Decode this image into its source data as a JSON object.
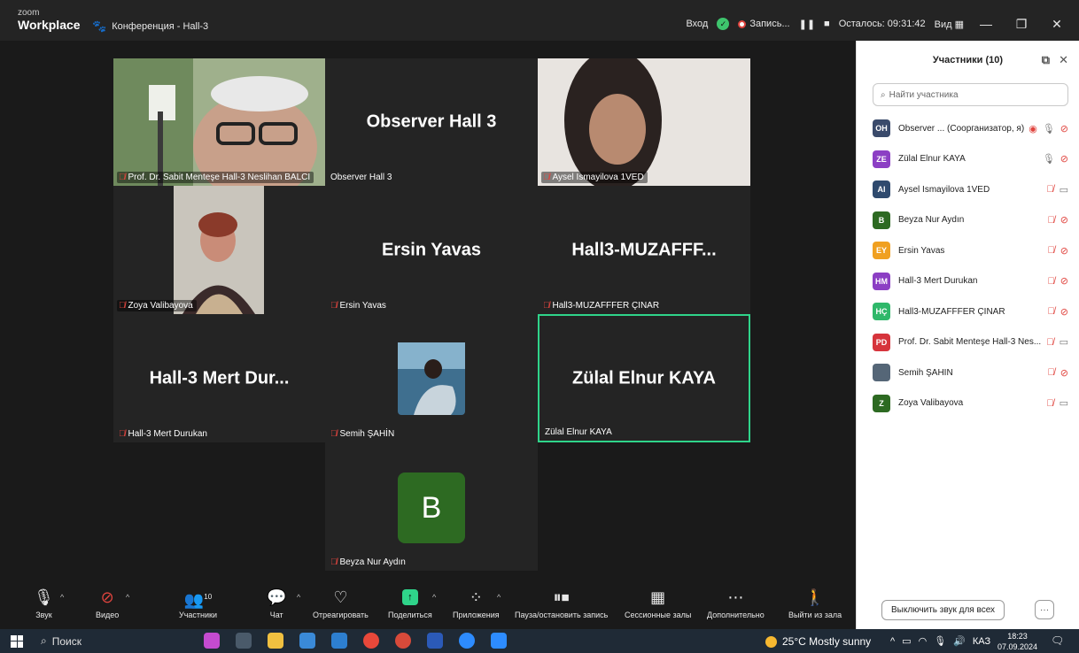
{
  "titlebar": {
    "logo_line1": "zoom",
    "logo_line2": "Workplace",
    "meeting_title": "Конференция - Hall-3",
    "login": "Вход",
    "recording": "Запись...",
    "remaining": "Осталось: 09:31:42",
    "view": "Вид"
  },
  "tiles": {
    "t1_label": "Prof. Dr. Sabit Menteşe Hall-3 Neslihan BALCI",
    "t2_name": "Observer Hall 3",
    "t2_label": "Observer Hall 3",
    "t3_label": "Aysel Ismayilova 1VED",
    "t4_label": "Zoya Valibayova",
    "t5_name": "Ersin Yavas",
    "t5_label": "Ersin Yavas",
    "t6_name": "Hall3-MUZAFFF...",
    "t6_label": "Hall3-MUZAFFFER ÇINAR",
    "t7_name": "Hall-3 Mert Dur...",
    "t7_label": "Hall-3 Mert Durukan",
    "t8_label": "Semih ŞAHİN",
    "t9_name": "Zülal Elnur KAYA",
    "t9_label": "Zülal Elnur KAYA",
    "t10_avatar": "B",
    "t10_label": "Beyza Nur Aydın"
  },
  "panel": {
    "title": "Участники (10)",
    "search_placeholder": "Найти участника",
    "participants": [
      {
        "initials": "OH",
        "name": "Observer ... (Соорганизатор, я)",
        "color": "#3a4a6b"
      },
      {
        "initials": "ZE",
        "name": "Zülal Elnur KAYA",
        "color": "#8c3fc4"
      },
      {
        "initials": "AI",
        "name": "Aysel Ismayilova 1VED",
        "color": "#2f4a6e"
      },
      {
        "initials": "B",
        "name": "Beyza Nur Aydın",
        "color": "#2d6a22"
      },
      {
        "initials": "EY",
        "name": "Ersin Yavas",
        "color": "#f0a020"
      },
      {
        "initials": "HM",
        "name": "Hall-3 Mert Durukan",
        "color": "#8c3fc4"
      },
      {
        "initials": "HÇ",
        "name": "Hall3-MUZAFFFER ÇINAR",
        "color": "#2fb86a"
      },
      {
        "initials": "PD",
        "name": "Prof. Dr. Sabit Menteşe Hall-3 Nes...",
        "color": "#d6343c"
      },
      {
        "initials": "",
        "name": "Semih ŞAHİN",
        "color": "#556677"
      },
      {
        "initials": "Z",
        "name": "Zoya Valibayova",
        "color": "#2d6a22"
      }
    ],
    "mute_all": "Выключить звук для всех"
  },
  "toolbar": {
    "audio": "Звук",
    "video": "Видео",
    "participants": "Участники",
    "participants_count": "10",
    "chat": "Чат",
    "react": "Отреагировать",
    "share": "Поделиться",
    "apps": "Приложения",
    "pause_record": "Пауза/остановить запись",
    "breakout": "Сессионные залы",
    "more": "Дополнительно",
    "leave": "Выйти из зала"
  },
  "taskbar": {
    "search": "Поиск",
    "weather": "25°C  Mostly sunny",
    "lang": "КАЗ",
    "time": "18:23",
    "date": "07.09.2024"
  }
}
